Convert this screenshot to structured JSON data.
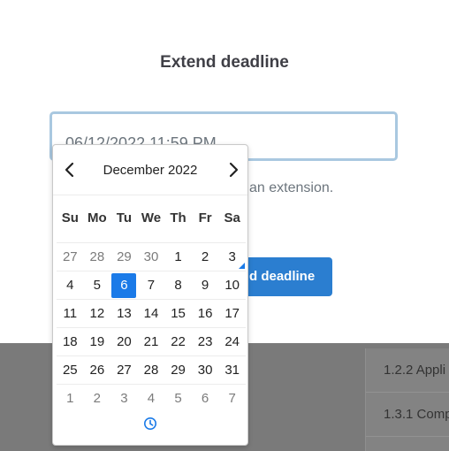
{
  "heading": "Extend deadline",
  "deadline_input": {
    "value": "06/12/2022 11:59 PM"
  },
  "help_text": "an extension.",
  "extend_button": "d deadline",
  "table_rows": [
    "1.2.2 Appli",
    "1.3.1 Comp"
  ],
  "picker": {
    "month_label": "December 2022",
    "weekdays": [
      "Su",
      "Mo",
      "Tu",
      "We",
      "Th",
      "Fr",
      "Sa"
    ],
    "weeks": [
      [
        "27",
        "28",
        "29",
        "30",
        "1",
        "2",
        "3"
      ],
      [
        "4",
        "5",
        "6",
        "7",
        "8",
        "9",
        "10"
      ],
      [
        "11",
        "12",
        "13",
        "14",
        "15",
        "16",
        "17"
      ],
      [
        "18",
        "19",
        "20",
        "21",
        "22",
        "23",
        "24"
      ],
      [
        "25",
        "26",
        "27",
        "28",
        "29",
        "30",
        "31"
      ],
      [
        "1",
        "2",
        "3",
        "4",
        "5",
        "6",
        "7"
      ]
    ],
    "selected_day": "6",
    "today_marker_day": "3"
  },
  "colors": {
    "accent": "#1a7ae8",
    "button": "#2b7ed0",
    "overlay": "#7a7a7a",
    "input_border": "#a9c8e0"
  },
  "icons": {
    "prev": "chevron-left-icon",
    "next": "chevron-right-icon",
    "time": "clock-icon"
  }
}
